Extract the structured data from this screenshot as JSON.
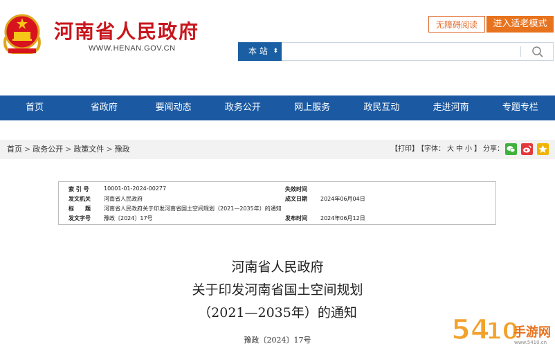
{
  "header": {
    "site_name": "河南省人民政府",
    "site_url": "WWW.HENAN.GOV.CN",
    "accessibility_label": "无障碍阅读",
    "elder_mode_label": "进入适老模式",
    "search_scope": "本 站",
    "search_placeholder": ""
  },
  "nav": {
    "items": [
      "首页",
      "省政府",
      "要闻动态",
      "政务公开",
      "网上服务",
      "政民互动",
      "走进河南",
      "专题专栏"
    ]
  },
  "breadcrumb": {
    "items": [
      "首页",
      "政务公开",
      "政策文件",
      "豫政"
    ],
    "separator": ">"
  },
  "tools": {
    "print": "【打印】",
    "font_label": "【字体：",
    "font_large": "大",
    "font_medium": "中",
    "font_small": "小",
    "font_close": "】",
    "share_label": "分享："
  },
  "info": {
    "index_label": "索 引 号",
    "index_value": "10001-01-2024-00277",
    "expiry_label": "失效时间",
    "expiry_value": "",
    "issuer_label": "发文机关",
    "issuer_value": "河南省人民政府",
    "written_date_label": "成文日期",
    "written_date_value": "2024年06月04日",
    "title_label": "标　　题",
    "title_value": "河南省人民政府关于印发河南省国土空间规划（2021—2035年）的通知",
    "doc_no_label": "发文字号",
    "doc_no_value": "豫政〔2024〕17号",
    "publish_date_label": "发布时间",
    "publish_date_value": "2024年06月12日"
  },
  "document": {
    "title_line1": "河南省人民政府",
    "title_line2": "关于印发河南省国土空间规划",
    "title_line3": "（2021—2035年）的通知",
    "number": "豫政〔2024〕17号"
  },
  "colors": {
    "brand_red": "#c8161d",
    "nav_blue": "#1b5aa3",
    "accent_orange": "#e8731e",
    "wechat_green": "#3fb13c",
    "weibo_red": "#e4393c",
    "qzone_yellow": "#f0b400"
  }
}
